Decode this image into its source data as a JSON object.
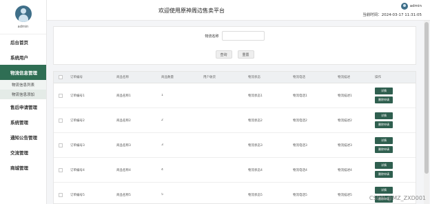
{
  "sidebar": {
    "user": "admin",
    "menu": [
      {
        "label": "后台首页"
      },
      {
        "label": "系统用户"
      },
      {
        "label": "物流信息管理",
        "active": true
      },
      {
        "label": "售后申请管理"
      },
      {
        "label": "系统管理"
      },
      {
        "label": "通知公告管理"
      },
      {
        "label": "交流管理"
      },
      {
        "label": "商城管理"
      }
    ],
    "submenu": [
      {
        "label": "物流信息列表"
      },
      {
        "label": "物流信息添加"
      }
    ]
  },
  "header": {
    "title": "欢迎使用原神周边售卖平台",
    "username": "admin",
    "time": "当前时间：2024-03-17 11:31:05"
  },
  "search": {
    "label": "物流名称",
    "query_label": "查询",
    "reset_label": "重置"
  },
  "table": {
    "headers": [
      "订单编号",
      "商品名称",
      "商品数量",
      "用户收货",
      "物流状态",
      "物流电话",
      "物流描述",
      "操作"
    ],
    "rows": [
      [
        "订单编号1",
        "商品名称1",
        "1",
        "",
        "物流状态1",
        "物流电话1",
        "物流描述1"
      ],
      [
        "订单编号2",
        "商品名称2",
        "2",
        "",
        "物流状态2",
        "物流电话2",
        "物流描述2"
      ],
      [
        "订单编号3",
        "商品名称3",
        "3",
        "",
        "物流状态3",
        "物流电话3",
        "物流描述3"
      ],
      [
        "订单编号4",
        "商品名称4",
        "4",
        "",
        "物流状态4",
        "物流电话4",
        "物流描述4"
      ],
      [
        "订单编号5",
        "商品名称5",
        "5",
        "",
        "物流状态5",
        "物流电话5",
        "物流描述5"
      ]
    ],
    "action_detail": "详情",
    "action_delete": "删除申请"
  },
  "watermark": "CSDN @MZ_ZXD001",
  "colors": {
    "accent": "#2f6e54",
    "button_dark": "#2f5f4f"
  }
}
